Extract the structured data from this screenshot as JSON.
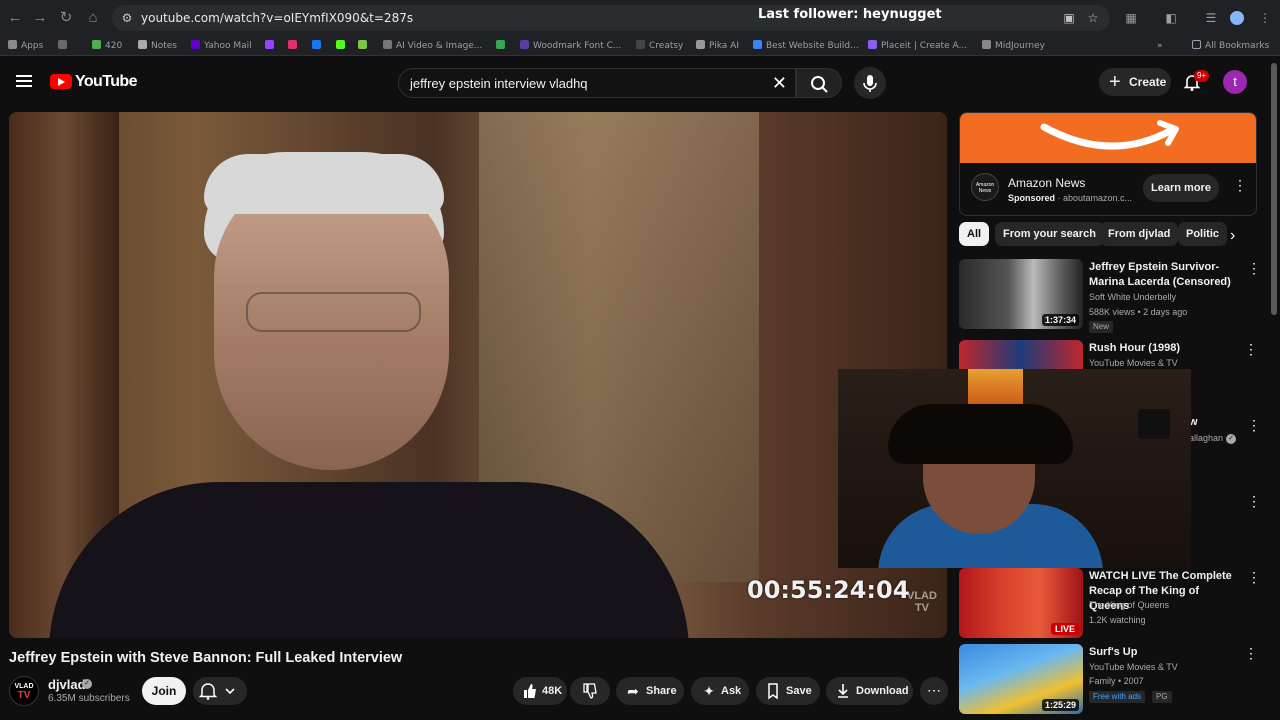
{
  "browser": {
    "url": "youtube.com/watch?v=oIEYmfIX090&t=287s",
    "overlay_text": "Last follower: heynugget",
    "bookmarks": [
      "Apps",
      "420",
      "Notes",
      "Yahoo Mail",
      "AI Video & Image...",
      "Woodmark Font C...",
      "Creatsy",
      "Pika AI",
      "Best Website Build...",
      "Placeit | Create A...",
      "MidJourney",
      "All Bookmarks"
    ]
  },
  "youtube": {
    "logo_text": "YouTube",
    "search_query": "jeffrey epstein interview vladhq",
    "create_label": "Create",
    "notification_badge": "9+",
    "avatar_letter": "t"
  },
  "video": {
    "timecode": "00:55:24:04",
    "watermark_line1": "VLAD",
    "watermark_line2": "TV",
    "title": "Jeffrey Epstein with Steve Bannon: Full Leaked Interview",
    "channel_name": "djvlad",
    "channel_avatar_line1": "VLAD",
    "channel_avatar_line2": "TV",
    "subscribers": "6.35M subscribers",
    "join_label": "Join",
    "likes": "48K",
    "share_label": "Share",
    "ask_label": "Ask",
    "save_label": "Save",
    "download_label": "Download"
  },
  "ad": {
    "title": "Amazon News",
    "sponsored_label": "Sponsored",
    "domain": "aboutamazon.c...",
    "logo_text": "Amazon News",
    "cta": "Learn more",
    "banner_color": "#f26c22"
  },
  "chips": [
    "All",
    "From your search",
    "From djvlad",
    "Politic"
  ],
  "recommendations": [
    {
      "title": "Jeffrey Epstein Survivor-Marina Lacerda (Censored)",
      "channel": "Soft White Underbelly",
      "meta": "588K views • 2 days ago",
      "duration": "1:37:34",
      "tag": "New"
    },
    {
      "title": "Rush Hour (1998)",
      "channel": "YouTube Movies & TV"
    },
    {
      "title": "WATCH LIVE The Complete Recap of The King of Queens",
      "channel": "The King of Queens",
      "meta": "1.2K watching",
      "live": "LIVE"
    },
    {
      "title": "Surf's Up",
      "channel": "YouTube Movies & TV",
      "meta": "Family • 2007",
      "duration": "1:25:29",
      "tag_free": "Free with ads",
      "rating": "PG"
    }
  ],
  "partial_text": {
    "line1": "w",
    "line2": "allaghan"
  }
}
